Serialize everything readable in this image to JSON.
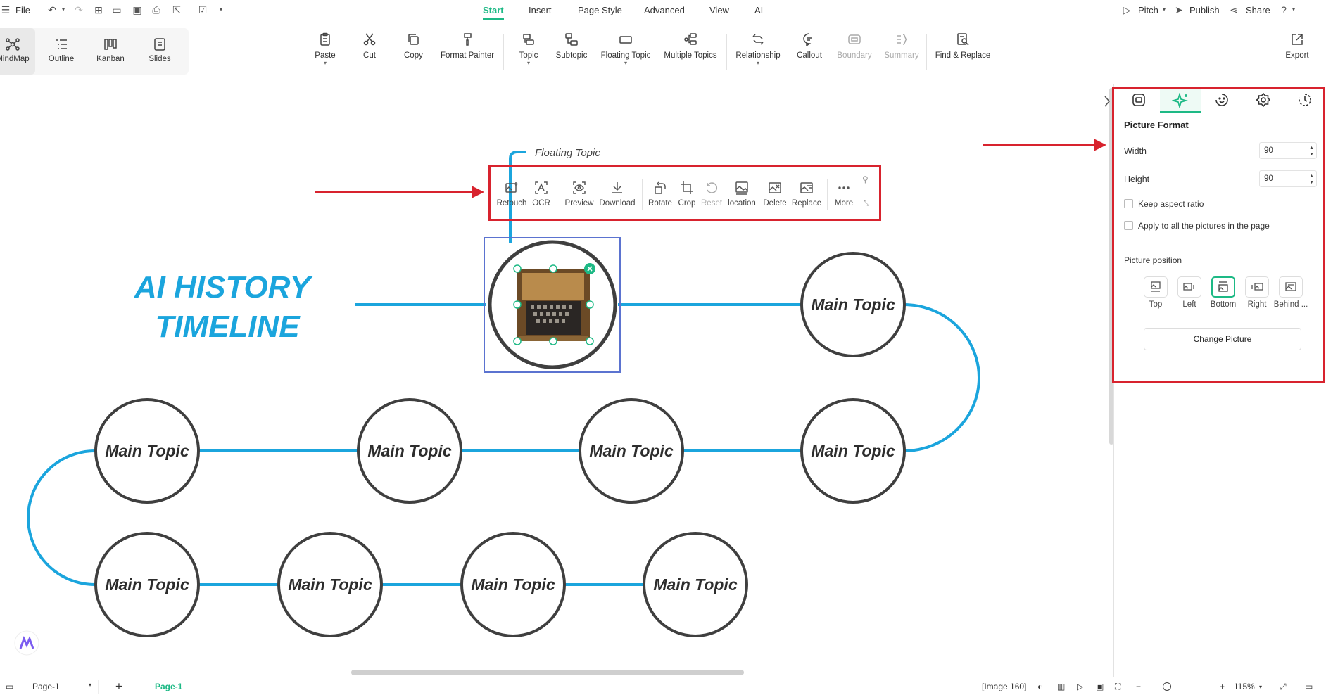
{
  "menubar": {
    "file": "File",
    "tabs": [
      {
        "label": "Start",
        "active": true
      },
      {
        "label": "Insert"
      },
      {
        "label": "Page Style"
      },
      {
        "label": "Advanced"
      },
      {
        "label": "View"
      },
      {
        "label": "AI"
      }
    ],
    "right": {
      "pitch": "Pitch",
      "publish": "Publish",
      "share": "Share"
    }
  },
  "views": [
    "MindMap",
    "Outline",
    "Kanban",
    "Slides"
  ],
  "ribbon": [
    "Paste",
    "Cut",
    "Copy",
    "Format Painter",
    "Topic",
    "Subtopic",
    "Floating Topic",
    "Multiple Topics",
    "Relationship",
    "Callout",
    "Boundary",
    "Summary",
    "Find & Replace",
    "Export"
  ],
  "canvas": {
    "title_line1": "AI HISTORY",
    "title_line2": "TIMELINE",
    "floating_topic": "Floating Topic",
    "topic_label": "Main Topic",
    "accent_color": "#1ba5dd",
    "title_color": "#1ba5dd"
  },
  "picture_toolbar": [
    "Retouch",
    "OCR",
    "Preview",
    "Download",
    "Rotate",
    "Crop",
    "Reset",
    "location",
    "Delete",
    "Replace",
    "More"
  ],
  "panel": {
    "section_title": "Picture Format",
    "width_label": "Width",
    "width_value": "90",
    "height_label": "Height",
    "height_value": "90",
    "keep_aspect": "Keep aspect ratio",
    "apply_all": "Apply to all the pictures in the page",
    "position_label": "Picture position",
    "positions": [
      "Top",
      "Left",
      "Bottom",
      "Right",
      "Behind ..."
    ],
    "selected_position": "Bottom",
    "change_picture": "Change Picture"
  },
  "status": {
    "page_dropdown": "Page-1",
    "page_tab": "Page-1",
    "image_info": "[Image 160]",
    "zoom": "115%"
  },
  "colors": {
    "brand": "#1db985",
    "highlight": "#d8232e"
  }
}
